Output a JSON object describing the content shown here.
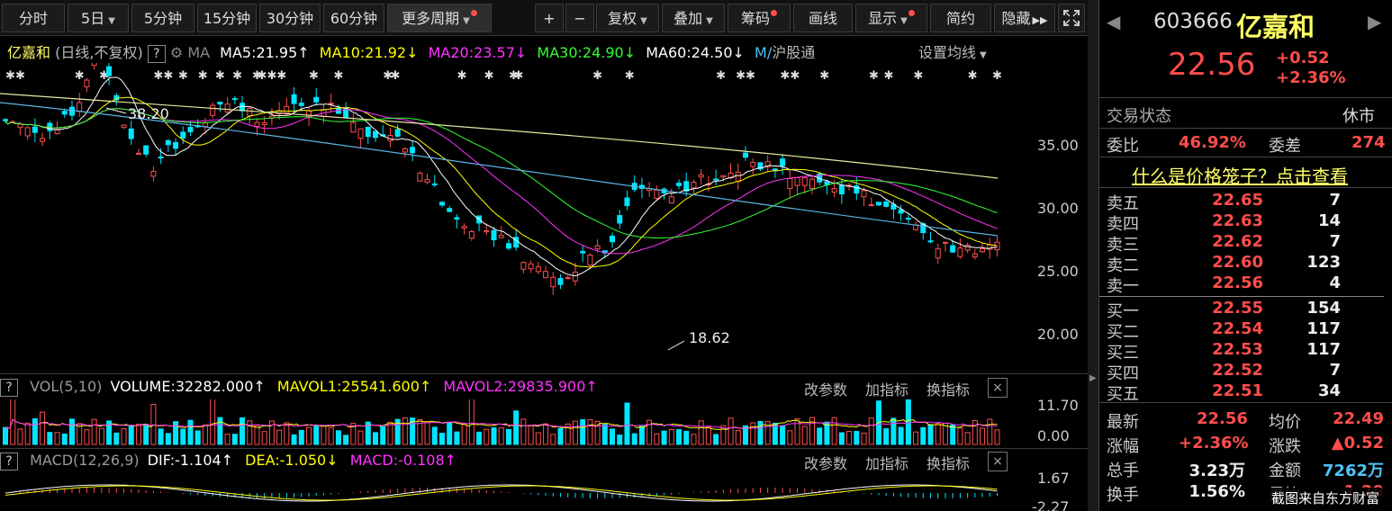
{
  "toolbar": {
    "buttons": [
      "分时",
      "5日",
      "5分钟",
      "15分钟",
      "30分钟",
      "60分钟",
      "更多周期"
    ],
    "right_buttons": [
      "+",
      "−",
      "复权",
      "叠加",
      "筹码",
      "画线",
      "显示",
      "简约",
      "隐藏"
    ],
    "fullscreen_icon": "fullscreen-icon"
  },
  "main_legend": {
    "name": "亿嘉和",
    "mode": "(日线,不复权)",
    "help": "?",
    "ma_label": "MA",
    "ma5": "MA5:21.95",
    "ma10": "MA10:21.92",
    "ma20": "MA20:23.57",
    "ma30": "MA30:24.90",
    "ma60": "MA60:24.50",
    "ma_cut": "M/",
    "hsgt": "沪股通",
    "set_ma": "设置均线",
    "ma_colors": {
      "ma5": "#ffffff",
      "ma10": "#ffff00",
      "ma20": "#ff00ff",
      "ma30": "#00ff00",
      "ma60": "#ffffff"
    }
  },
  "price_axis": [
    "35.00",
    "30.00",
    "25.00",
    "20.00"
  ],
  "annotations": {
    "high": "38.20",
    "low": "18.62"
  },
  "vol_legend": {
    "help": "?",
    "title": "VOL(5,10)",
    "volume": "VOLUME:32282.000",
    "mavol1": "MAVOL1:25541.600",
    "mavol2": "MAVOL2:29835.900",
    "params": "改参数",
    "add": "加指标",
    "swap": "换指标",
    "close": "×"
  },
  "vol_axis": [
    "11.70",
    "0.00"
  ],
  "macd_legend": {
    "help": "?",
    "title": "MACD(12,26,9)",
    "dif": "DIF:-1.104",
    "dea": "DEA:-1.050",
    "macd": "MACD:-0.108",
    "params": "改参数",
    "add": "加指标",
    "swap": "换指标",
    "close": "×"
  },
  "macd_axis": [
    "1.67",
    "-2.27"
  ],
  "stock": {
    "code": "603666",
    "name": "亿嘉和",
    "price": "22.56",
    "change": "+0.52",
    "change_pct": "+2.36%",
    "trade_status_label": "交易状态",
    "trade_status": "休市",
    "weibi_label": "委比",
    "weibi": "46.92%",
    "weicha_label": "委差",
    "weicha": "274",
    "cage_link": "什么是价格笼子？点击查看"
  },
  "asks": [
    {
      "label": "卖五",
      "price": "22.65",
      "vol": "7"
    },
    {
      "label": "卖四",
      "price": "22.63",
      "vol": "14"
    },
    {
      "label": "卖三",
      "price": "22.62",
      "vol": "7"
    },
    {
      "label": "卖二",
      "price": "22.60",
      "vol": "123"
    },
    {
      "label": "卖一",
      "price": "22.56",
      "vol": "4"
    }
  ],
  "bids": [
    {
      "label": "买一",
      "price": "22.55",
      "vol": "154"
    },
    {
      "label": "买二",
      "price": "22.54",
      "vol": "117"
    },
    {
      "label": "买三",
      "price": "22.53",
      "vol": "117"
    },
    {
      "label": "买四",
      "price": "22.52",
      "vol": "7"
    },
    {
      "label": "买五",
      "price": "22.51",
      "vol": "34"
    }
  ],
  "quote": {
    "latest_label": "最新",
    "latest": "22.56",
    "avg_label": "均价",
    "avg": "22.49",
    "pct_label": "涨幅",
    "pct": "+2.36%",
    "chg_label": "涨跌",
    "chg": "▲0.52",
    "total_label": "总手",
    "total": "3.23万",
    "amount_label": "金额",
    "amount": "7262万",
    "turnover_label": "换手",
    "turnover": "1.56%",
    "ratio_label": "量比",
    "ratio": "1.29"
  },
  "watermark": "截图来自东方财富"
}
